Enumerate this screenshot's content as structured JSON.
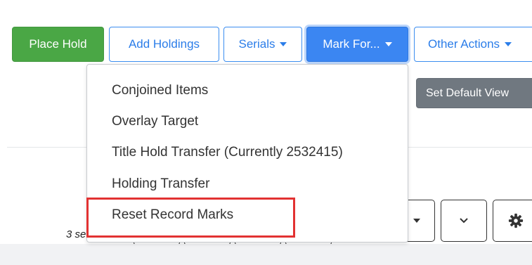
{
  "toolbar": {
    "place_hold": "Place Hold",
    "add_holdings": "Add Holdings",
    "serials": "Serials",
    "mark_for": "Mark For...",
    "other_actions": "Other Actions"
  },
  "set_default_view": "Set Default View",
  "mark_for_menu": {
    "items": [
      "Conjoined Items",
      "Overlay Target",
      "Title Hold Transfer (Currently 2532415)",
      "Holding Transfer",
      "Reset Record Marks"
    ]
  },
  "results_count_partial": "3 se",
  "colors": {
    "success": "#4aa745",
    "primary": "#3b86f2",
    "secondary": "#707880",
    "highlight": "#e23232"
  }
}
